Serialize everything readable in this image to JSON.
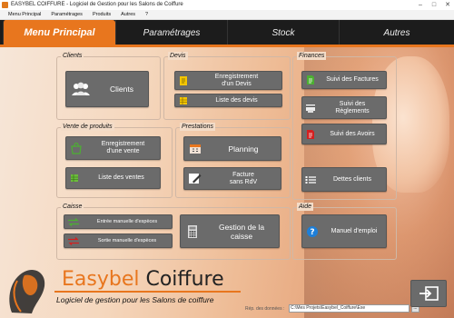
{
  "window": {
    "title": "EASYBEL COIFFURE - Logiciel de Gestion pour les Salons de Coiffure",
    "controls": [
      "–",
      "□",
      "✕"
    ]
  },
  "menubar": [
    "Menu Principal",
    "Paramétrages",
    "Produits",
    "Autres",
    "?"
  ],
  "tabs": [
    "Menu Principal",
    "Paramétrages",
    "Stock",
    "Autres"
  ],
  "groups": {
    "clients": {
      "label": "Clients",
      "buttons": [
        "Clients"
      ]
    },
    "devis": {
      "label": "Devis",
      "buttons": [
        "Enregistrement\nd'un Devis",
        "Liste des devis"
      ]
    },
    "finances": {
      "label": "Finances",
      "buttons": [
        "Suivi des Factures",
        "Suivi des\nRèglements",
        "Suivi des Avoirs",
        "Dettes clients"
      ]
    },
    "vente": {
      "label": "Vente de produits",
      "buttons": [
        "Enregistrement\nd'une vente",
        "Liste des ventes"
      ]
    },
    "prestations": {
      "label": "Prestations",
      "buttons": [
        "Planning",
        "Facture\nsans RdV"
      ]
    },
    "caisse": {
      "label": "Caisse",
      "buttons": [
        "Entrée manuelle d'espèces",
        "Sortie manuelle d'espèces",
        "Gestion de la\ncaisse"
      ]
    },
    "aide": {
      "label": "Aide",
      "buttons": [
        "Manuel d'emploi"
      ]
    }
  },
  "brand": {
    "name_first": "Easybel",
    "name_second": " Coiffure",
    "tagline": "Logiciel de gestion pour les Salons de coiffure"
  },
  "footer": {
    "rep_label": "Rép. des données :",
    "rep_value": "C:\\Mes Projets\\Easybel_Coiffure\\Exe",
    "rep_button": "..."
  },
  "colors": {
    "accent": "#e8761e",
    "button": "#6b6b6b",
    "tabbar": "#1c1c1c"
  }
}
